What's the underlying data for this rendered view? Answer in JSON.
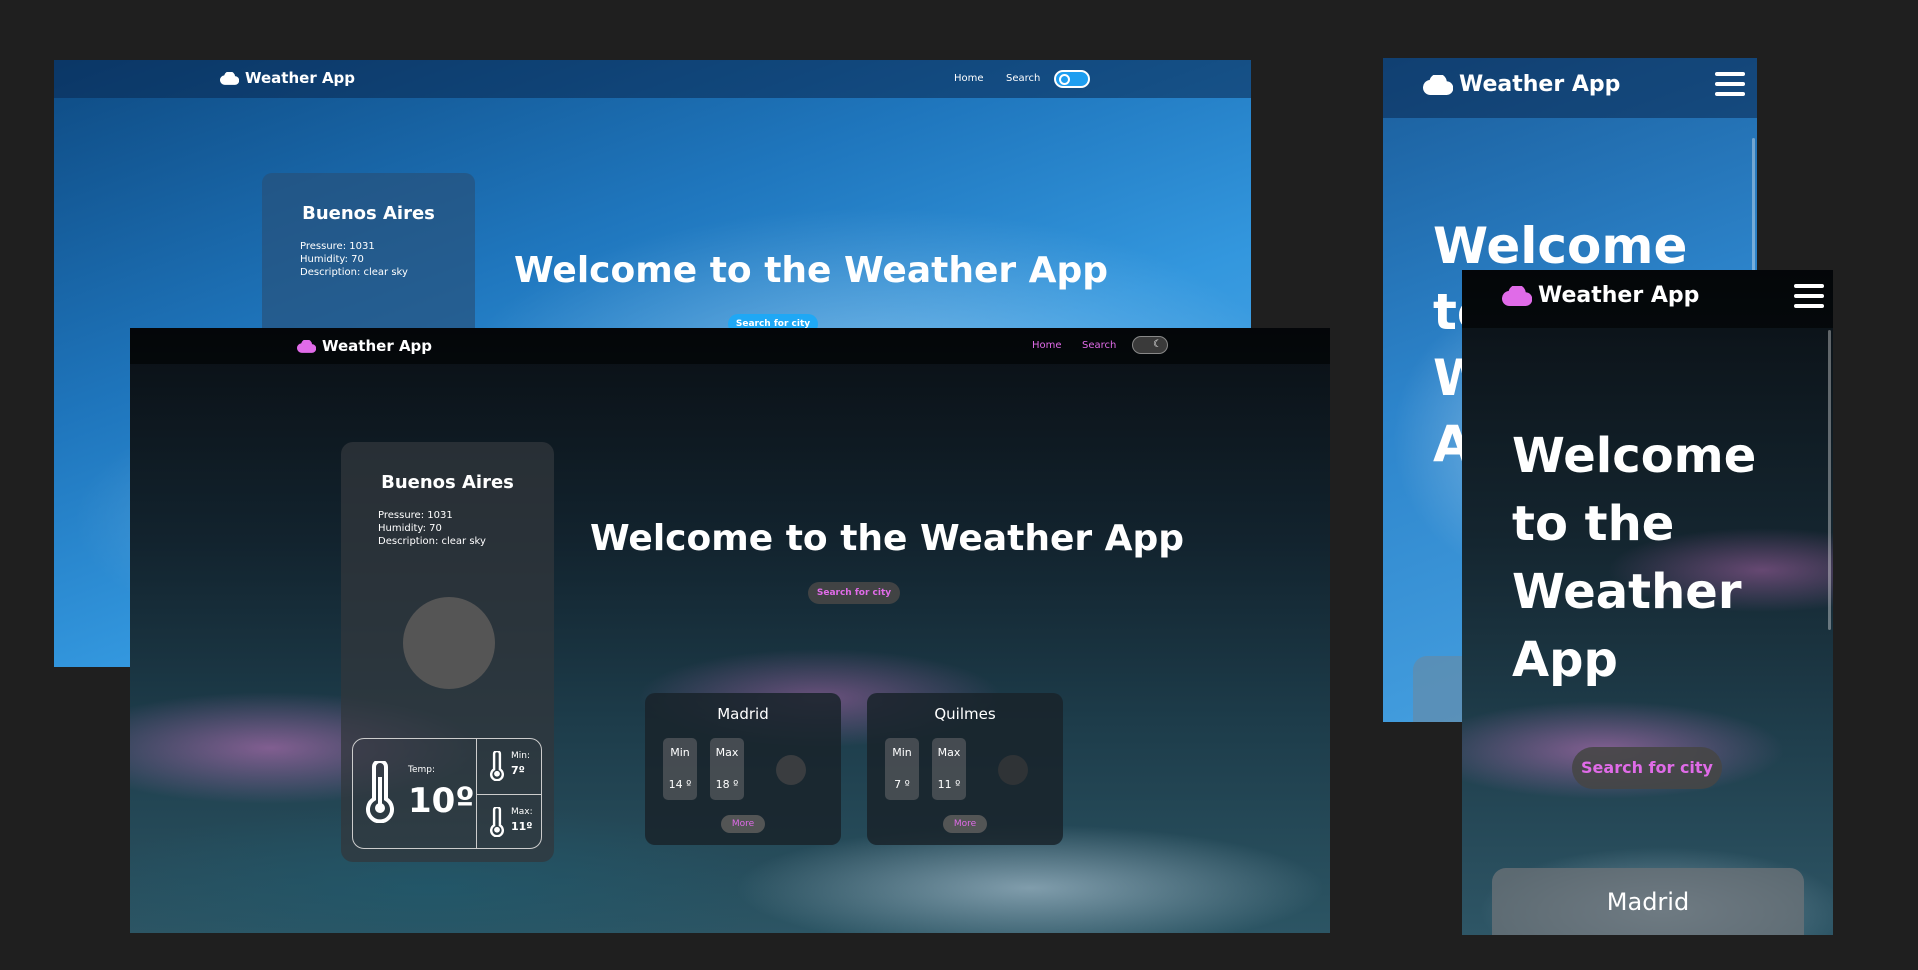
{
  "app": {
    "brand": "Weather App"
  },
  "nav": {
    "home": "Home",
    "search": "Search"
  },
  "hero": {
    "welcome": "Welcome to the Weather App",
    "search_button": "Search for city"
  },
  "main_card": {
    "city": "Buenos Aires",
    "pressure": "Pressure: 1031",
    "humidity": "Humidity: 70",
    "description": "Description: clear sky",
    "temp_label": "Temp:",
    "temp_value": "10º",
    "min_label": "Min:",
    "min_value": "7º",
    "max_label": "Max:",
    "max_value": "11º"
  },
  "mini_cards": [
    {
      "city": "Madrid",
      "min_label": "Min",
      "min_value": "14 º",
      "max_label": "Max",
      "max_value": "18 º",
      "more": "More"
    },
    {
      "city": "Quilmes",
      "min_label": "Min",
      "min_value": "7 º",
      "max_label": "Max",
      "max_value": "11 º",
      "more": "More"
    }
  ],
  "mobile": {
    "welcome_lines_light": [
      "Welcome",
      "to",
      "W",
      "A"
    ],
    "welcome_lines_dark": [
      "Welcome",
      "to the",
      "Weather",
      "App"
    ],
    "mobile_card_city": "Madrid"
  },
  "colors": {
    "accent_dark": "#e06be8",
    "accent_light": "#1fa8f5",
    "bg": "#1f1f1f"
  },
  "icons": {
    "brand": "cloud-icon",
    "menu": "hamburger-icon",
    "thermometer": "thermometer-icon",
    "theme": "moon-icon"
  }
}
